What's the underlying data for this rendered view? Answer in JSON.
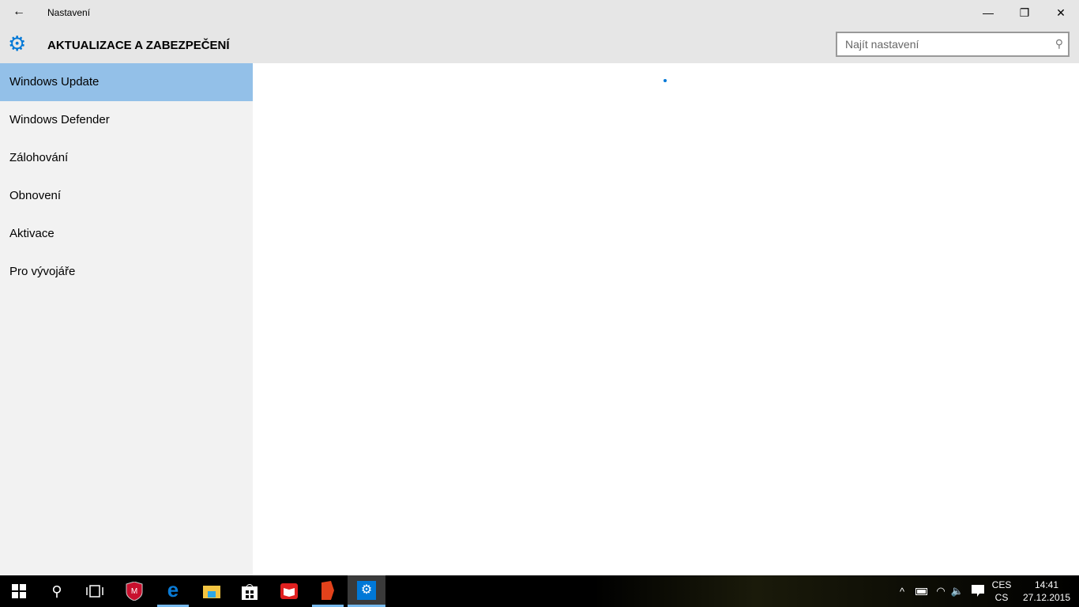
{
  "window": {
    "title": "Nastavení",
    "back": "←",
    "minimize": "—",
    "restore": "❐",
    "close": "✕"
  },
  "header": {
    "title": "AKTUALIZACE A ZABEZPEČENÍ",
    "search_placeholder": "Najít nastavení"
  },
  "sidebar": {
    "items": [
      {
        "label": "Windows Update",
        "selected": true
      },
      {
        "label": "Windows Defender"
      },
      {
        "label": "Zálohování"
      },
      {
        "label": "Obnovení"
      },
      {
        "label": "Aktivace"
      },
      {
        "label": "Pro vývojáře"
      }
    ]
  },
  "taskbar": {
    "lang_top": "CES",
    "lang_bottom": "CS",
    "time": "14:41",
    "date": "27.12.2015"
  },
  "colors": {
    "accent": "#0078d7",
    "selected": "#93c0e8"
  }
}
